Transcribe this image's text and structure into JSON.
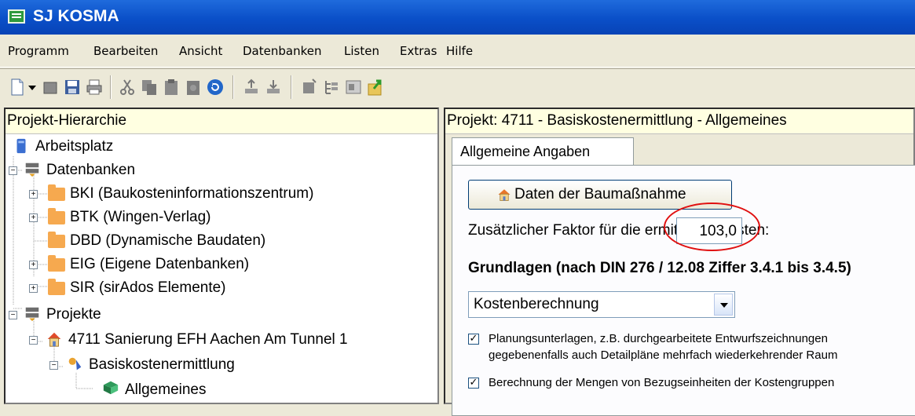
{
  "window": {
    "title": "SJ KOSMA"
  },
  "menu": [
    "Programm",
    "Bearbeiten",
    "Ansicht",
    "Datenbanken",
    "Listen",
    "Extras",
    "Hilfe"
  ],
  "left_panel": {
    "header": "Projekt-Hierarchie",
    "items": [
      {
        "label": "Arbeitsplatz"
      },
      {
        "label": "Datenbanken"
      },
      {
        "label": "BKI (Baukosteninformationszentrum)"
      },
      {
        "label": "BTK (Wingen-Verlag)"
      },
      {
        "label": "DBD (Dynamische Baudaten)"
      },
      {
        "label": "EIG (Eigene Datenbanken)"
      },
      {
        "label": "SIR (sirAdos Elemente)"
      },
      {
        "label": "Projekte"
      },
      {
        "label": "4711 Sanierung EFH Aachen Am Tunnel 1"
      },
      {
        "label": "Basiskostenermittlung"
      },
      {
        "label": "Allgemeines"
      }
    ]
  },
  "right_panel": {
    "header": "Projekt: 4711 - Basiskostenermittlung - Allgemeines",
    "tab": "Allgemeine Angaben",
    "button": "Daten der Baumaßnahme",
    "factor_label": "Zusätzlicher Faktor für die ermittelten Kosten:",
    "factor_value": "103,0",
    "section_title": "Grundlagen (nach DIN 276 / 12.08 Ziffer 3.4.1 bis 3.4.5)",
    "select_value": "Kostenberechnung",
    "checkbox1": {
      "checked": true,
      "line1": "Planungsunterlagen, z.B. durchgearbeitete Entwurfszeichnungen",
      "line2": "gegebenenfalls auch Detailpläne mehrfach wiederkehrender Raum"
    },
    "checkbox2": {
      "checked": true,
      "text": "Berechnung der Mengen von Bezugseinheiten der Kostengruppen"
    }
  },
  "colors": {
    "titlebar": "#0a4fc8",
    "highlight_ellipse": "#e01010",
    "header_bg": "#ffffe1"
  }
}
